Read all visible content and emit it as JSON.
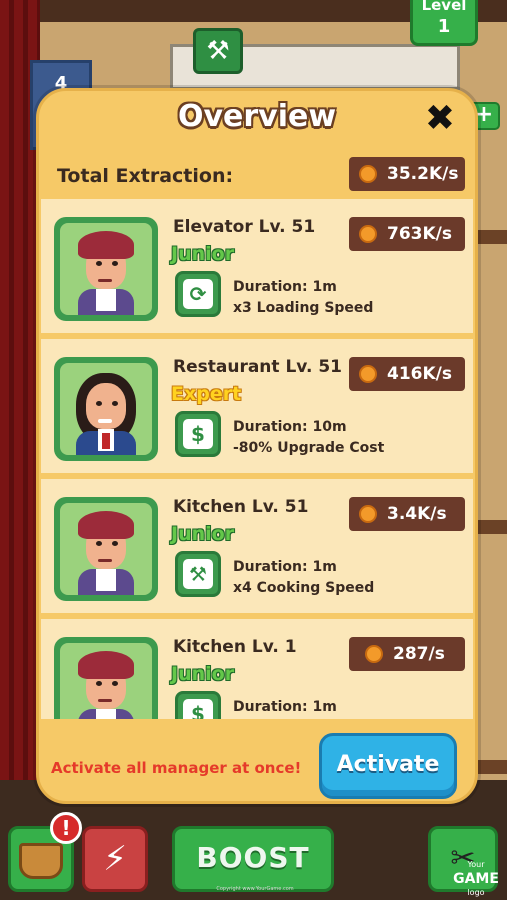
{
  "background": {
    "level_label": "Level",
    "level_value": "1",
    "floor_number": "4",
    "alert_badge": "!",
    "boost_label": "BOOST",
    "watermark_line1": "Your",
    "watermark_line2": "GAME",
    "watermark_line3": "logo",
    "copyright": "Copyright www.YourGame.com"
  },
  "overview": {
    "title": "Overview",
    "close_icon": "close-icon",
    "total_label": "Total Extraction:",
    "total_rate": "35.2K/s",
    "managers": [
      {
        "title": "Elevator Lv. 51",
        "rank": "Junior",
        "rate": "763K/s",
        "duration": "Duration: 1m",
        "effect": "x3 Loading Speed",
        "icon": "elevator-icon",
        "avatar": "red-hair-manager"
      },
      {
        "title": "Restaurant Lv. 51",
        "rank": "Expert",
        "rate": "416K/s",
        "duration": "Duration: 10m",
        "effect": "-80% Upgrade Cost",
        "icon": "dollar-icon",
        "avatar": "curly-hair-manager"
      },
      {
        "title": "Kitchen Lv. 51",
        "rank": "Junior",
        "rate": "3.4K/s",
        "duration": "Duration: 1m",
        "effect": "x4 Cooking Speed",
        "icon": "fork-spatula-icon",
        "avatar": "red-hair-manager"
      },
      {
        "title": "Kitchen Lv. 1",
        "rank": "Junior",
        "rate": "287/s",
        "duration": "Duration: 1m",
        "effect": "",
        "icon": "dollar-icon",
        "avatar": "red-hair-manager"
      }
    ],
    "footer_message": "Activate all manager at once!",
    "activate_label": "Activate"
  },
  "colors": {
    "panel": "#f6c967",
    "card": "#fbe7b9",
    "rate_pill": "#6b3a2a",
    "junior": "#64c84a",
    "expert": "#ffd21f",
    "activate": "#2fb2e6",
    "footer_text": "#e53a2a"
  }
}
